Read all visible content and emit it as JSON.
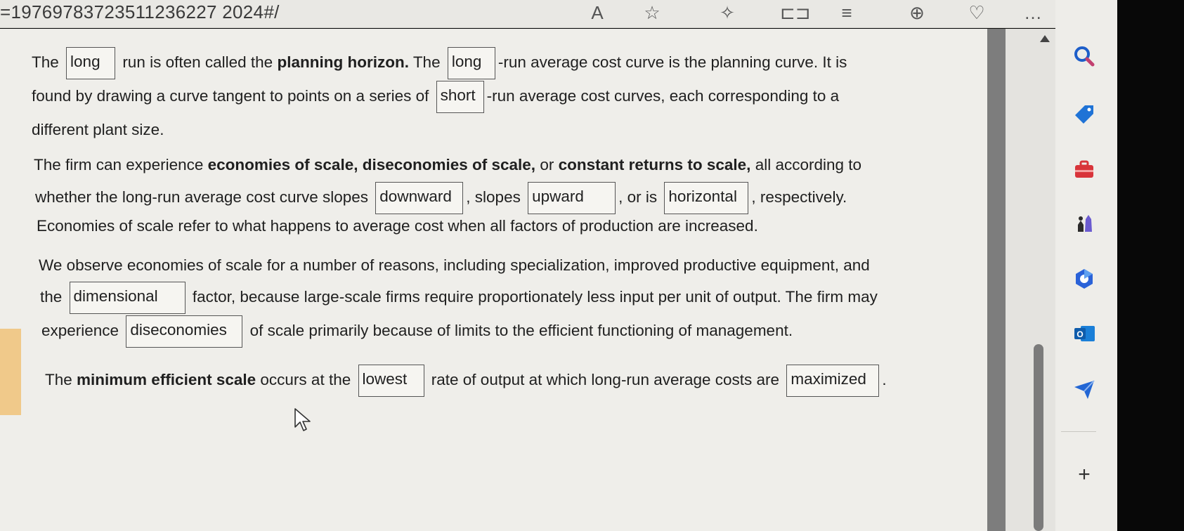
{
  "browser": {
    "url_fragment": "=19769783723511236227 2024#/",
    "toolbar_icons": [
      "read-aloud-icon",
      "favorite-icon",
      "extensions-icon",
      "split-screen-icon",
      "favorites-list-icon",
      "collections-icon",
      "performance-icon",
      "more-icon"
    ]
  },
  "question": {
    "p1": {
      "t1": "The",
      "b1": "long",
      "t2": "run is often called the",
      "bold1": "planning horizon.",
      "t3": "The",
      "b2": "long",
      "t4": "-run average cost curve is the planning curve. It is",
      "t5": "found by drawing a curve tangent to points on a series of",
      "b3": "short",
      "t6": "-run average cost curves, each corresponding to a",
      "t7": "different plant size."
    },
    "p2": {
      "t1": "The firm can experience",
      "bold1": "economies of scale, diseconomies of scale,",
      "t2": "or",
      "bold2": "constant returns to scale,",
      "t3": "all according to",
      "t4": "whether the long-run average cost curve slopes",
      "b1": "downward",
      "t5": ", slopes",
      "b2": "upward",
      "t6": ", or is",
      "b3": "horizontal",
      "t7": ", respectively.",
      "t8": "Economies of scale refer to what happens to average cost when all factors of production are increased."
    },
    "p3": {
      "t1": "We observe economies of scale for a number of reasons, including specialization, improved productive equipment, and",
      "t2": "the",
      "b1": "dimensional",
      "t3": "factor, because large-scale firms require proportionately less input per unit of output. The firm may",
      "t4": "experience",
      "b2": "diseconomies",
      "t5": "of scale primarily because of limits to the efficient functioning of management."
    },
    "p4": {
      "t1": "The",
      "bold1": "minimum efficient scale",
      "t2": "occurs at the",
      "b1": "lowest",
      "t3": "rate of output at which long-run average costs are",
      "b2": "maximized",
      "t4": "."
    }
  },
  "sidebar": {
    "icons": [
      "search-icon",
      "shopping-tag-icon",
      "tools-icon",
      "games-icon",
      "microsoft-365-icon",
      "outlook-icon",
      "send-icon"
    ],
    "add_label": "+"
  },
  "colors": {
    "page_bg": "#efeeea",
    "left_tab": "#f0c98a"
  }
}
